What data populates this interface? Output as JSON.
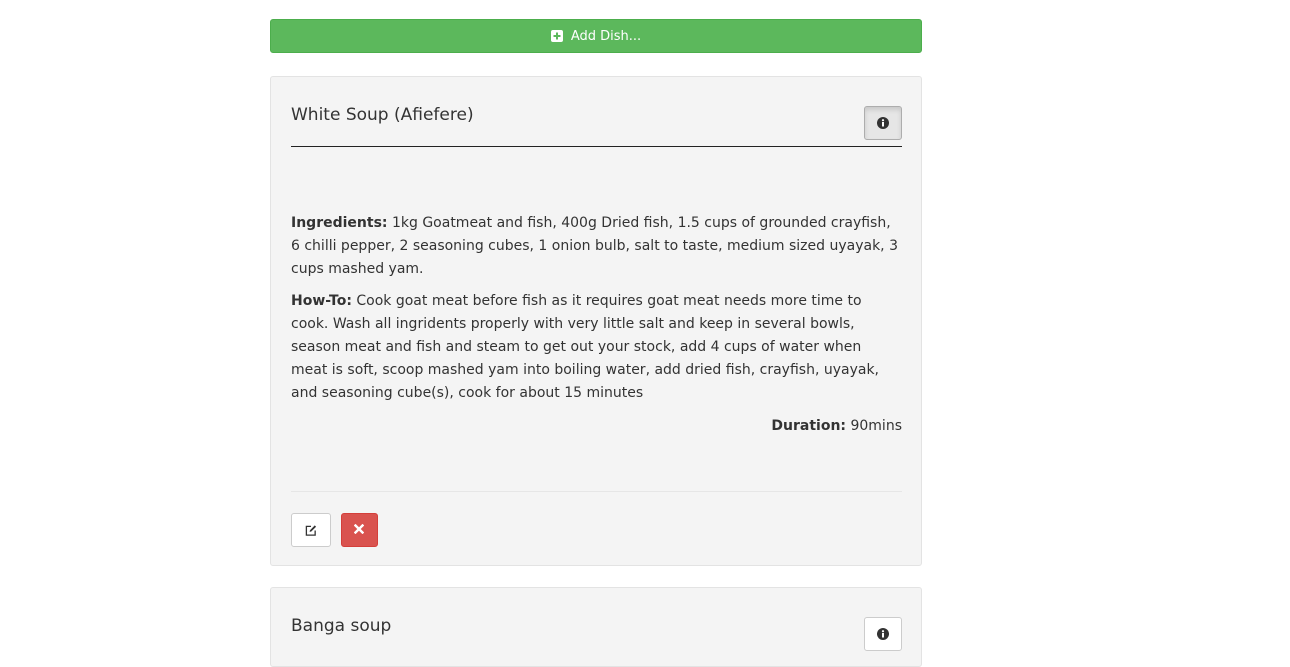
{
  "toolbar": {
    "add_dish_label": "Add Dish..."
  },
  "dishes": [
    {
      "title": "White Soup (Afiefere)",
      "ingredients_label": "Ingredients:",
      "ingredients": "1kg Goatmeat and fish, 400g Dried fish, 1.5 cups of grounded crayfish, 6 chilli pepper, 2 seasoning cubes, 1 onion bulb, salt to taste, medium sized uyayak, 3 cups mashed yam.",
      "howto_label": "How-To:",
      "howto": "Cook goat meat before fish as it requires goat meat needs more time to cook. Wash all ingridents properly with very little salt and keep in several bowls, season meat and fish and steam to get out your stock, add 4 cups of water when meat is soft, scoop mashed yam into boiling water, add dried fish, crayfish, uyayak, and seasoning cube(s), cook for about 15 minutes",
      "duration_label": "Duration:",
      "duration": "90mins"
    },
    {
      "title": "Banga soup"
    }
  ],
  "colors": {
    "success": "#5cb85c",
    "danger": "#d9534f",
    "card_bg": "#f4f4f4"
  },
  "icons": {
    "add": "plus-square-icon",
    "info": "info-circle-icon",
    "edit": "edit-icon",
    "delete": "close-icon"
  }
}
